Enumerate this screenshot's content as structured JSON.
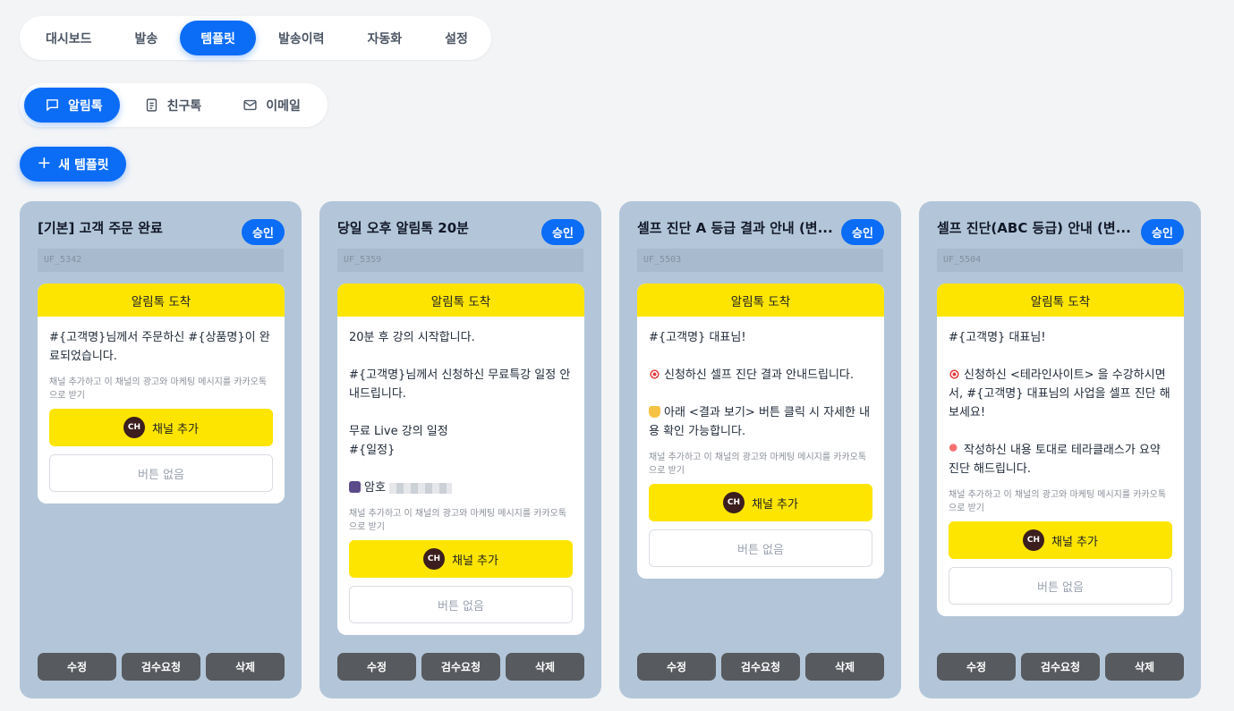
{
  "main_nav": {
    "items": [
      "대시보드",
      "발송",
      "템플릿",
      "발송이력",
      "자동화",
      "설정"
    ],
    "active_index": 2
  },
  "sub_tabs": {
    "items": [
      {
        "label": "알림톡",
        "icon": "chat-bubble-icon"
      },
      {
        "label": "친구톡",
        "icon": "document-icon"
      },
      {
        "label": "이메일",
        "icon": "mail-icon"
      }
    ],
    "active_index": 0
  },
  "new_template_label": "새 템플릿",
  "common": {
    "preview_header": "알림톡 도착",
    "notice": "채널 추가하고 이 채널의 광고와 마케팅 메시지를 카카오톡으로 받기",
    "ch_icon": "CH",
    "add_channel": "채널 추가",
    "no_button": "버튼 없음",
    "actions": [
      "수정",
      "검수요청",
      "삭제"
    ]
  },
  "colors": {
    "accent": "#0b6cf6",
    "card_bg": "#b3c6d9",
    "kakao_yellow": "#fee500",
    "action_button": "#575a5e"
  },
  "cards": [
    {
      "title": "[기본] 고객 주문 완료",
      "status": "승인",
      "code": "UF_5342",
      "lines": [
        {
          "text": "#{고객명}님께서 주문하신 #{상품명}이 완료되었습니다."
        }
      ]
    },
    {
      "title": "당일 오후 알림톡 20분",
      "status": "승인",
      "code": "UF_5359",
      "lines": [
        {
          "text": "20분 후 강의 시작합니다."
        },
        {
          "text": ""
        },
        {
          "text": "#{고객명}님께서 신청하신 무료특강 일정 안내드립니다."
        },
        {
          "text": ""
        },
        {
          "text": "무료 Live 강의 일정"
        },
        {
          "text": "#{일정}"
        },
        {
          "text": ""
        },
        {
          "text": "암호",
          "icon": "camera",
          "masked": true
        }
      ]
    },
    {
      "title": "셀프 진단 A 등급 결과 안내 (변...",
      "status": "승인",
      "code": "UF_5503",
      "lines": [
        {
          "text": "#{고객명} 대표님!"
        },
        {
          "text": ""
        },
        {
          "text": "신청하신 셀프 진단 결과 안내드립니다.",
          "icon": "target"
        },
        {
          "text": ""
        },
        {
          "text": "아래 <결과 보기> 버튼 클릭 시 자세한 내용 확인 가능합니다.",
          "icon": "hand"
        }
      ]
    },
    {
      "title": "셀프 진단(ABC 등급) 안내 (변...",
      "status": "승인",
      "code": "UF_5504",
      "lines": [
        {
          "text": "#{고객명} 대표님!"
        },
        {
          "text": ""
        },
        {
          "text": "신청하신 <테라인사이트> 을 수강하시면서, #{고객명} 대표님의 사업을 셀프 진단 해보세요!",
          "icon": "target"
        },
        {
          "text": ""
        },
        {
          "text": "작성하신 내용 토대로 테라클래스가 요약 진단 해드립니다.",
          "icon": "pin"
        }
      ]
    }
  ]
}
